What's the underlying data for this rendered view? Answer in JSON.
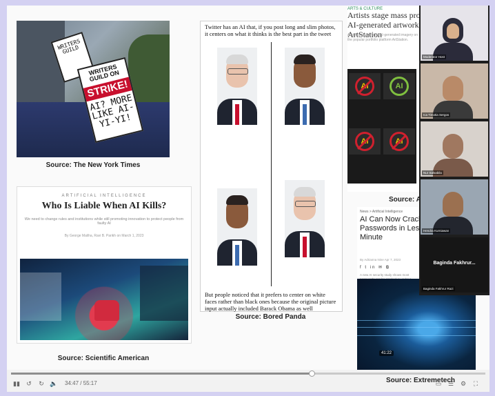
{
  "slide": {
    "strike_photo": {
      "sign_main_top": "WRITERS GUILD ON",
      "sign_main_strike": "STRIKE!",
      "sign_main_hand": "AI? MORE LIKE AI-YI-YI!",
      "sign_small": "WRITERS GUILD"
    },
    "caption_nyt": "Source: The New York Times",
    "article_sa": {
      "kicker": "ARTIFICIAL INTELLIGENCE",
      "headline": "Who Is Liable When AI Kills?",
      "dek": "We need to change rules and institutions while still promoting innovation to protect people from faulty AI",
      "byline": "By George Maliha, Ravi B. Parikh on March 1, 2023"
    },
    "caption_sa": "Source: Scientific American",
    "bored_panda": {
      "intro": "Twitter has an AI that, if you post long and slim photos, it centers on what it thinks is the best part in the tweet",
      "outro": "But people noticed that it prefers to center on white faces rather than black ones because the original picture input actually included Barack Obama as well"
    },
    "caption_bp": "Source: Bored Panda",
    "artists_article": {
      "kicker": "ARTS & CULTURE",
      "headline": "Artists stage mass protest against AI-generated artwork on ArtStation",
      "dek": "Artists are protesting AI-generated imagery on the popular portfolio platform ArtStation.",
      "ai_label": "AI"
    },
    "caption_ars": "Source: Ars",
    "extremetech": {
      "category": "News > Artificial Intelligence",
      "headline": "AI Can Now Crack Most Passwords in Less Than a Minute",
      "meta": "By Adrianna Nine  Apr 7, 2023",
      "share": "f  t  in  ✉  ⧉",
      "body": "A new AI security study shows most passwords can be cracked in under a minute.",
      "thumb_time": "41:22"
    },
    "caption_et": "Source: Extremetech"
  },
  "participants": [
    {
      "label": "Moderator Host"
    },
    {
      "label": "Ica Timotia Sergos"
    },
    {
      "label": "Nur Salsabila"
    },
    {
      "label": "Hendra Kurniawan"
    },
    {
      "label": "Baginda Fakhrur Razi",
      "big": "Baginda Fakhrur..."
    }
  ],
  "player": {
    "timecode": "34:47 / 55:17",
    "progress": 0.633
  },
  "colors": {
    "background": "#d4d1f2",
    "strike_red": "#c8102e",
    "player_bar": "#f2f2f2"
  }
}
